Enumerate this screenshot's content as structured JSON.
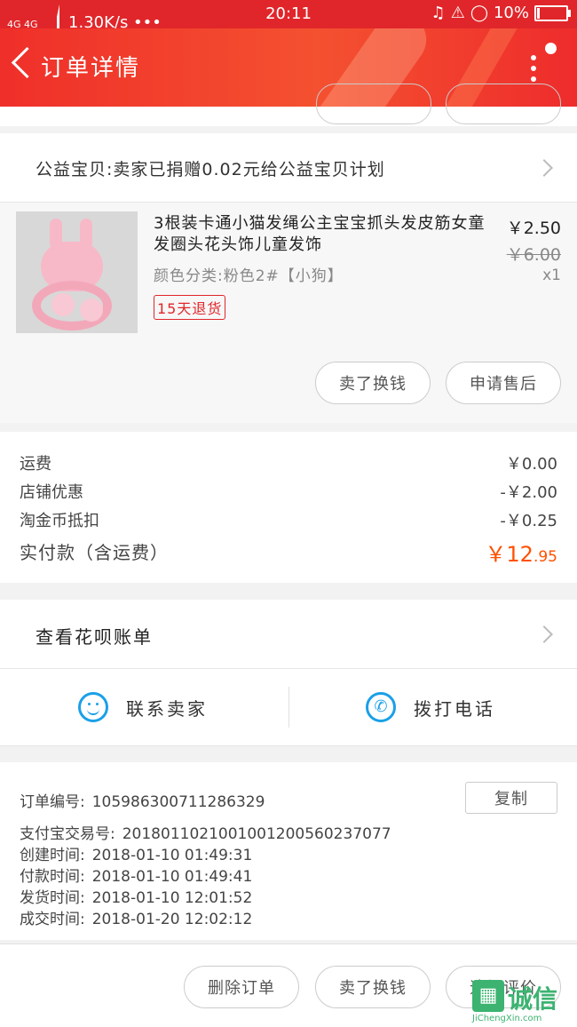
{
  "status": {
    "network": "4G 4G",
    "speed": "1.30K/s •••",
    "time": "20:11",
    "battery": "10%"
  },
  "header": {
    "title": "订单详情"
  },
  "charity": {
    "text": "公益宝贝:卖家已捐赠0.02元给公益宝贝计划"
  },
  "product": {
    "title": "3根装卡通小猫发绳公主宝宝抓头发皮筋女童发圈头花头饰儿童发饰",
    "sku": "颜色分类:粉色2#【小狗】",
    "price": "￥2.50",
    "original_price": "￥6.00",
    "quantity": "x1",
    "return_tag": "15天退货",
    "sell_label": "卖了换钱",
    "aftersale_label": "申请售后"
  },
  "summary": {
    "shipping_label": "运费",
    "shipping_value": "￥0.00",
    "shop_discount_label": "店铺优惠",
    "shop_discount_value": "-￥2.00",
    "coin_label": "淘金币抵扣",
    "coin_value": "-￥0.25",
    "paid_label": "实付款（含运费）",
    "paid_yuan": "￥12",
    "paid_cents": ".95",
    "accent": "#ff5000"
  },
  "huabei": {
    "label": "查看花呗账单"
  },
  "contact": {
    "seller_label": "联系卖家",
    "call_label": "拨打电话",
    "icon_color": "#1aa0e8"
  },
  "order": {
    "number_label": "订单编号:",
    "number": "105986300711286329",
    "copy_label": "复制",
    "alipay_label": "支付宝交易号:",
    "alipay": "2018011021001001200560237077",
    "created_label": "创建时间:",
    "created": "2018-01-10 01:49:31",
    "paid_label": "付款时间:",
    "paid": "2018-01-10 01:49:41",
    "shipped_label": "发货时间:",
    "shipped": "2018-01-10 12:01:52",
    "done_label": "成交时间:",
    "done": "2018-01-20 12:02:12"
  },
  "bottom_bar": {
    "delete_label": "删除订单",
    "sell_label": "卖了换钱",
    "review_label": "追加评价"
  },
  "watermark": {
    "text": "诚信",
    "domain": "JiChengXin.com"
  }
}
